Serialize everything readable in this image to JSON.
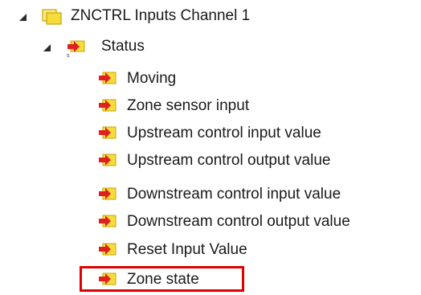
{
  "tree": {
    "root": {
      "label": "ZNCTRL Inputs Channel 1",
      "icon": "input-group-icon",
      "expanded": true
    },
    "status": {
      "label": "Status",
      "icon": "status-input-group-icon",
      "expanded": true
    },
    "items": [
      {
        "label": "Moving",
        "icon": "input-variable-icon"
      },
      {
        "label": "Zone sensor input",
        "icon": "input-variable-icon"
      },
      {
        "label": "Upstream control input value",
        "icon": "input-variable-icon"
      },
      {
        "label": "Upstream control output value",
        "icon": "input-variable-icon"
      },
      {
        "label": "Downstream control input value",
        "icon": "input-variable-icon"
      },
      {
        "label": "Downstream control output value",
        "icon": "input-variable-icon"
      },
      {
        "label": "Reset Input Value",
        "icon": "input-variable-icon"
      },
      {
        "label": "Zone state",
        "icon": "input-variable-icon",
        "highlighted": true
      }
    ]
  },
  "colors": {
    "highlight_border": "#e00000",
    "icon_yellow": "#f6dc3c",
    "icon_red": "#e02020"
  }
}
